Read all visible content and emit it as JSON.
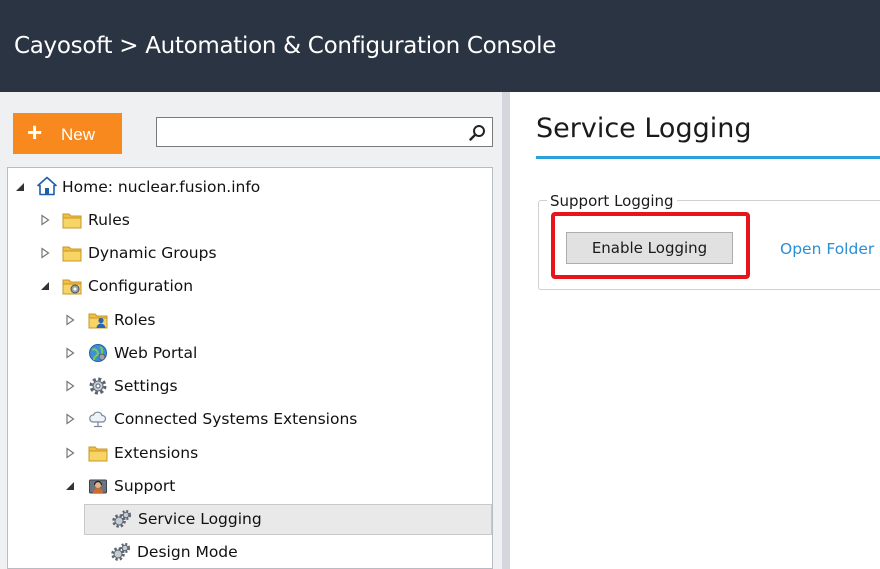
{
  "window": {
    "title": "Cayosoft > Automation & Configuration Console"
  },
  "toolbar": {
    "new_plus": "+",
    "new_label": "New",
    "search_value": "",
    "search_placeholder": ""
  },
  "tree": {
    "items": [
      {
        "label": "Home: nuclear.fusion.info",
        "icon": "home-icon",
        "expanded": true
      },
      {
        "label": "Rules",
        "icon": "folder-icon",
        "expanded": false
      },
      {
        "label": "Dynamic Groups",
        "icon": "folder-icon",
        "expanded": false
      },
      {
        "label": "Configuration",
        "icon": "folder-gear-icon",
        "expanded": true
      },
      {
        "label": "Roles",
        "icon": "folder-user-icon",
        "expanded": false
      },
      {
        "label": "Web Portal",
        "icon": "globe-icon",
        "expanded": false
      },
      {
        "label": "Settings",
        "icon": "gear-icon",
        "expanded": false
      },
      {
        "label": "Connected Systems Extensions",
        "icon": "cloud-icon",
        "expanded": false
      },
      {
        "label": "Extensions",
        "icon": "folder-icon",
        "expanded": false
      },
      {
        "label": "Support",
        "icon": "support-icon",
        "expanded": true
      },
      {
        "label": "Service Logging",
        "icon": "gears-icon",
        "selected": true
      },
      {
        "label": "Design Mode",
        "icon": "gears-icon"
      }
    ]
  },
  "main": {
    "page_title": "Service Logging",
    "group": {
      "legend": "Support Logging",
      "enable_button": "Enable Logging",
      "open_folder_link": "Open Folder L"
    }
  },
  "colors": {
    "titlebar": "#2b3442",
    "new_button": "#f7891f",
    "accent_underline": "#2aa0dc",
    "highlight": "#e8141c",
    "link": "#2a8fd6"
  }
}
